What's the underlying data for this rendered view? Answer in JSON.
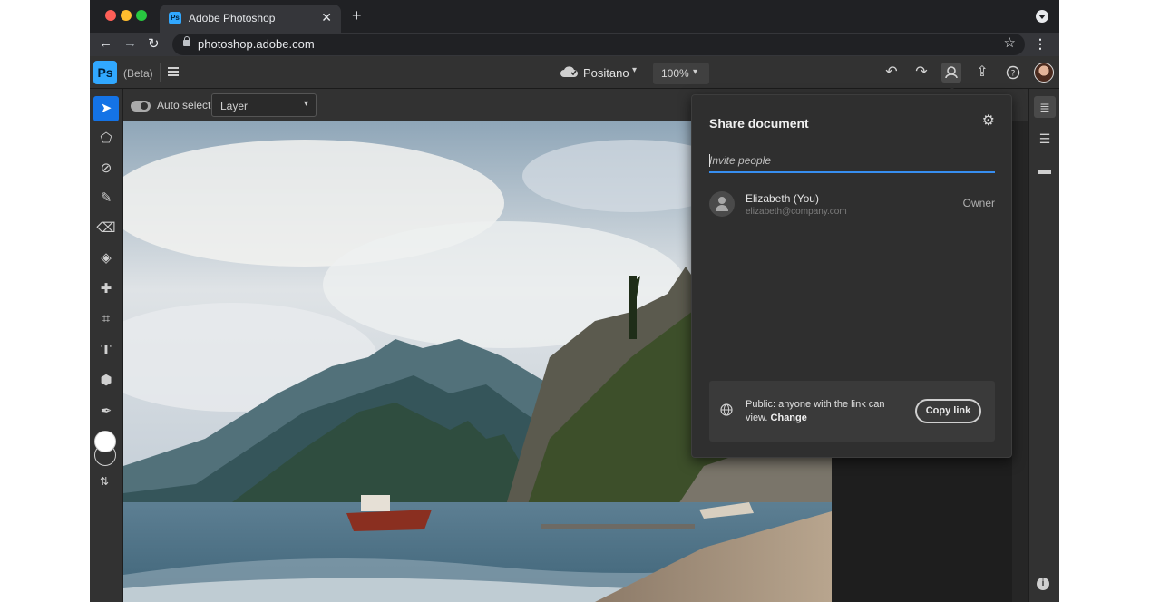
{
  "browser": {
    "tab_title": "Adobe Photoshop",
    "tab_favicon": "Ps",
    "url": "photoshop.adobe.com"
  },
  "app": {
    "logo": "Ps",
    "beta_label": "(Beta)",
    "document_name": "Positano",
    "zoom": "100%",
    "accent_color": "#31a8ff",
    "active_tool_color": "#1473e6"
  },
  "options_bar": {
    "auto_select_label": "Auto select",
    "layer_select_value": "Layer"
  },
  "tools": [
    "move-tool",
    "lasso-tool",
    "quick-selection-tool",
    "brush-tool",
    "eraser-tool",
    "paint-bucket-tool",
    "healing-tool",
    "crop-tool",
    "type-tool",
    "shape-tool",
    "eyedropper-tool"
  ],
  "share_panel": {
    "title": "Share document",
    "invite_placeholder": "Invite people",
    "people": [
      {
        "name": "Elizabeth (You)",
        "email": "elizabeth@company.com",
        "role": "Owner"
      }
    ],
    "link_text": "Public: anyone with the link can view.",
    "change_label": "Change",
    "copy_button": "Copy link"
  }
}
